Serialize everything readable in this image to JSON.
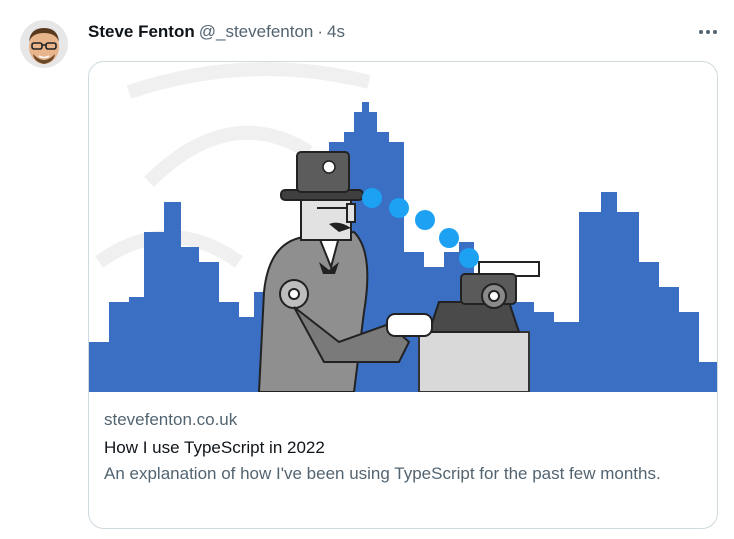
{
  "tweet": {
    "author": {
      "display_name": "Steve Fenton",
      "handle": "@_stevefenton",
      "avatar_icon": "cartoon-face-avatar"
    },
    "separator": "·",
    "timestamp": "4s",
    "more_icon": "ellipsis-icon"
  },
  "card": {
    "image_icon": "robot-typewriter-skyline-illustration",
    "domain": "stevefenton.co.uk",
    "title": "How I use TypeScript in 2022",
    "description": "An explanation of how I've been using TypeScript for the past few months."
  },
  "colors": {
    "skyline": "#3a6fc4",
    "dots": "#1da1f2",
    "border": "#cfd9de",
    "secondary_text": "#536471"
  }
}
